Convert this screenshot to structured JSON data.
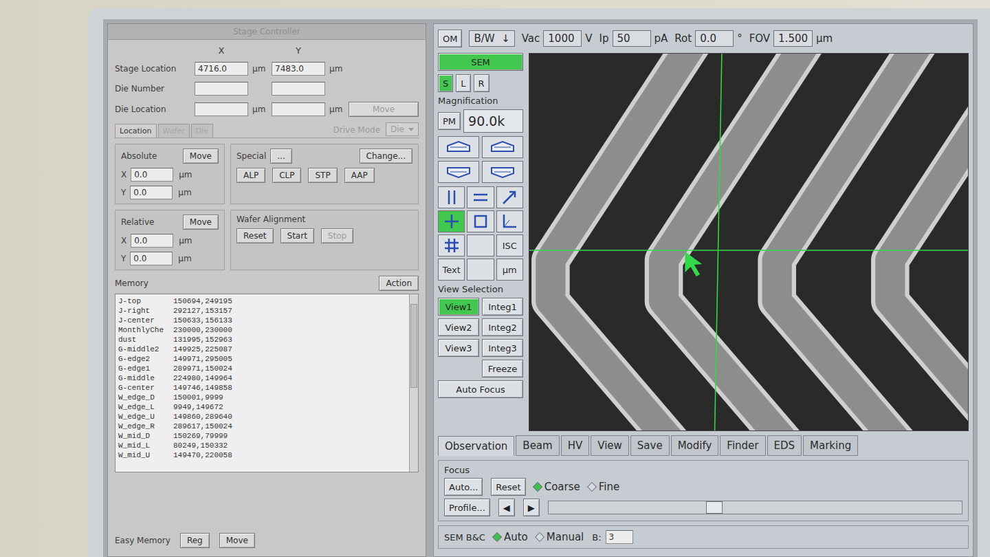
{
  "stage_controller": {
    "title": "Stage Controller",
    "columns": [
      "X",
      "Y"
    ],
    "rows": [
      {
        "label": "Stage Location",
        "x": "4716.0",
        "y": "7483.0",
        "unit": "µm"
      },
      {
        "label": "Die Number",
        "x": "",
        "y": "",
        "unit": ""
      },
      {
        "label": "Die Location",
        "x": "",
        "y": "",
        "unit": "µm"
      }
    ],
    "die_move": {
      "label": "Move",
      "disabled": true
    },
    "tabs": [
      {
        "label": "Location",
        "selected": true,
        "disabled": false
      },
      {
        "label": "Wafer",
        "selected": false,
        "disabled": true
      },
      {
        "label": "Die",
        "selected": false,
        "disabled": true
      }
    ],
    "drive_mode": {
      "label": "Drive Mode",
      "value": "Die",
      "disabled": true
    },
    "absolute": {
      "title": "Absolute",
      "button": "Move",
      "fields": [
        {
          "axis": "X",
          "value": "0.0",
          "unit": "µm"
        },
        {
          "axis": "Y",
          "value": "0.0",
          "unit": "µm"
        }
      ]
    },
    "special": {
      "title": "Special",
      "more": "...",
      "change": "Change...",
      "buttons": [
        "ALP",
        "CLP",
        "STP",
        "AAP"
      ]
    },
    "relative": {
      "title": "Relative",
      "button": "Move",
      "fields": [
        {
          "axis": "X",
          "value": "0.0",
          "unit": "µm"
        },
        {
          "axis": "Y",
          "value": "0.0",
          "unit": "µm"
        }
      ]
    },
    "wafer_alignment": {
      "title": "Wafer Alignment",
      "buttons": [
        {
          "label": "Reset",
          "disabled": false
        },
        {
          "label": "Start",
          "disabled": false
        },
        {
          "label": "Stop",
          "disabled": true
        }
      ]
    },
    "memory": {
      "title": "Memory",
      "action": "Action",
      "entries": [
        {
          "name": "J-top",
          "coords": "150694,249195"
        },
        {
          "name": "J-right",
          "coords": "292127,153157"
        },
        {
          "name": "J-center",
          "coords": "150633,156133"
        },
        {
          "name": "MonthlyChe",
          "coords": "230000,230000"
        },
        {
          "name": "dust",
          "coords": "131995,152963"
        },
        {
          "name": "G-middle2",
          "coords": "149925,225087"
        },
        {
          "name": "G-edge2",
          "coords": "149971,295005"
        },
        {
          "name": "G-edge1",
          "coords": "289971,150024"
        },
        {
          "name": "G-middle",
          "coords": "224980,149964"
        },
        {
          "name": "G-center",
          "coords": "149746,149858"
        },
        {
          "name": "W_edge_D",
          "coords": "150001,9999"
        },
        {
          "name": "W_edge_L",
          "coords": "9949,149672"
        },
        {
          "name": "W_edge_U",
          "coords": "149860,289640"
        },
        {
          "name": "W_edge_R",
          "coords": "289617,150024"
        },
        {
          "name": "W_mid_D",
          "coords": "150269,79999"
        },
        {
          "name": "W_mid_L",
          "coords": "80249,150332"
        },
        {
          "name": "W_mid_U",
          "coords": "149470,220058"
        }
      ]
    },
    "easy_memory": {
      "title": "Easy Memory",
      "buttons": [
        "Reg",
        "Move"
      ]
    }
  },
  "sem": {
    "top_bar": {
      "om": "OM",
      "mode": "B/W",
      "mode_arrow": "↓",
      "params": [
        {
          "label": "Vac",
          "value": "1000",
          "unit": "V"
        },
        {
          "label": "Ip",
          "value": "50",
          "unit": "pA"
        },
        {
          "label": "Rot",
          "value": "0.0",
          "unit": "°"
        },
        {
          "label": "FOV",
          "value": "1.500",
          "unit": "µm"
        }
      ]
    },
    "sem_button": {
      "label": "SEM",
      "active": true
    },
    "detectors": [
      {
        "label": "S",
        "selected": true
      },
      {
        "label": "L",
        "selected": false
      },
      {
        "label": "R",
        "selected": false
      }
    ],
    "magnification": {
      "title": "Magnification",
      "button": "PM",
      "value": "90.0k"
    },
    "tools": [
      {
        "kind": "vertical",
        "label": "",
        "selected": false
      },
      {
        "kind": "horizontal",
        "label": "",
        "selected": false
      },
      {
        "kind": "diagonal",
        "label": "",
        "selected": false
      },
      {
        "kind": "cross",
        "label": "",
        "selected": true
      },
      {
        "kind": "box",
        "label": "",
        "selected": false
      },
      {
        "kind": "angle",
        "label": "",
        "selected": false
      },
      {
        "kind": "grid",
        "label": "",
        "selected": false
      },
      {
        "kind": "blank",
        "label": "",
        "selected": false
      },
      {
        "kind": "text",
        "label": "ISC",
        "selected": false
      },
      {
        "kind": "text",
        "label": "Text",
        "selected": false
      },
      {
        "kind": "blank",
        "label": "",
        "selected": false
      },
      {
        "kind": "text",
        "label": "µm",
        "selected": false
      }
    ],
    "view_selection": {
      "title": "View Selection",
      "buttons": [
        {
          "label": "View1",
          "selected": true
        },
        {
          "label": "Integ1",
          "selected": false
        },
        {
          "label": "View2",
          "selected": false
        },
        {
          "label": "Integ2",
          "selected": false
        },
        {
          "label": "View3",
          "selected": false
        },
        {
          "label": "Integ3",
          "selected": false
        }
      ],
      "freeze": "Freeze",
      "auto_focus": "Auto Focus"
    },
    "tabs": [
      {
        "label": "Observation",
        "selected": true
      },
      {
        "label": "Beam",
        "selected": false
      },
      {
        "label": "HV",
        "selected": false
      },
      {
        "label": "View",
        "selected": false
      },
      {
        "label": "Save",
        "selected": false
      },
      {
        "label": "Modify",
        "selected": false
      },
      {
        "label": "Finder",
        "selected": false
      },
      {
        "label": "EDS",
        "selected": false
      },
      {
        "label": "Marking",
        "selected": false
      }
    ],
    "focus": {
      "title": "Focus",
      "auto": "Auto...",
      "reset": "Reset",
      "profile": "Profile...",
      "modes": [
        {
          "label": "Coarse",
          "selected": true
        },
        {
          "label": "Fine",
          "selected": false
        }
      ],
      "left": "◀",
      "right": "▶",
      "level": 0.4
    },
    "bc": {
      "title": "SEM B&C",
      "modes": [
        {
          "label": "Auto",
          "selected": true
        },
        {
          "label": "Manual",
          "selected": false
        }
      ],
      "b_label": "B:",
      "b_value": "3"
    }
  }
}
